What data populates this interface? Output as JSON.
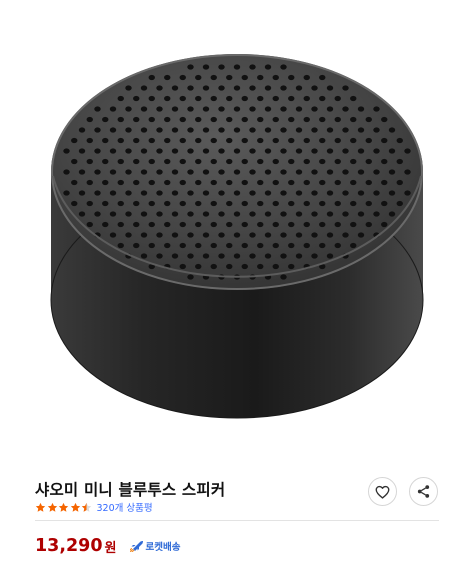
{
  "product": {
    "title": "샤오미 미니 블루투스 스피커",
    "rating": 4.5,
    "rating_max": 5,
    "review_count_label": "320개 상품평",
    "price": "13,290",
    "currency": "원",
    "delivery_badge": "로켓배송"
  },
  "icons": {
    "image": "bluetooth-speaker-image",
    "like": "heart-icon",
    "share": "share-icon",
    "delivery": "rocket-icon"
  },
  "colors": {
    "price": "#ae0000",
    "star": "#f56500",
    "link": "#346aff",
    "rocket": "#2f6ad6",
    "speaker_body": "#2e2e2e"
  }
}
